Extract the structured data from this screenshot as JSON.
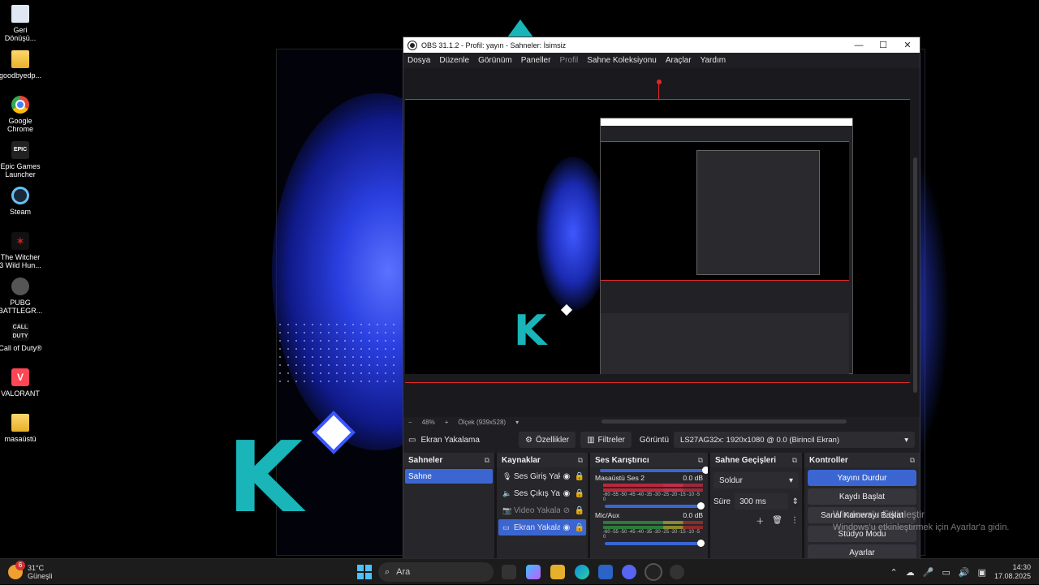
{
  "desktop": {
    "icons": [
      {
        "label": "Geri Dönüşü...",
        "icon": "recycle-bin-icon"
      },
      {
        "label": "goodbyedp...",
        "icon": "folder-icon"
      },
      {
        "label": "Google Chrome",
        "icon": "chrome-icon"
      },
      {
        "label": "Epic Games Launcher",
        "icon": "epic-games-icon"
      },
      {
        "label": "Steam",
        "icon": "steam-icon"
      },
      {
        "label": "The Witcher 3 Wild Hun...",
        "icon": "witcher-icon"
      },
      {
        "label": "PUBG BATTLEGR...",
        "icon": "pubg-icon"
      },
      {
        "label": "Call of Duty®",
        "icon": "cod-icon"
      },
      {
        "label": "VALORANT",
        "icon": "valorant-icon"
      },
      {
        "label": "masaüstü",
        "icon": "folder-icon"
      }
    ],
    "epic_text": "EPIC",
    "cod_text": "CALL DUTY",
    "valorant_text": "V",
    "big_k": "K"
  },
  "obs": {
    "title": "OBS 31.1.2 - Profil: yayın - Sahneler: İsimsiz",
    "window_buttons": {
      "minimize": "—",
      "maximize": "☐",
      "close": "✕"
    },
    "menu": [
      {
        "label": "Dosya"
      },
      {
        "label": "Düzenle"
      },
      {
        "label": "Görünüm"
      },
      {
        "label": "Paneller"
      },
      {
        "label": "Profil",
        "dim": true
      },
      {
        "label": "Sahne Koleksiyonu"
      },
      {
        "label": "Araçlar"
      },
      {
        "label": "Yardım"
      }
    ],
    "preview_status": {
      "zoom_minus": "−",
      "zoom": "48%",
      "zoom_plus": "+",
      "scale": "Ölçek (939x528)"
    },
    "source_toolbar": {
      "source_name": "Ekran Yakalama",
      "properties": "Özellikler",
      "filters": "Filtreler",
      "display_label": "Görüntü",
      "display_value": "LS27AG32x: 1920x1080 @ 0.0 (Birincil Ekran)"
    },
    "scenes": {
      "title": "Sahneler",
      "items": [
        "Sahne"
      ]
    },
    "sources": {
      "title": "Kaynaklar",
      "items": [
        {
          "name": "Ses Giriş Yakalama",
          "icon": "mic-icon",
          "visible": true,
          "dim": false,
          "selected": false
        },
        {
          "name": "Ses Çıkış Yakalama",
          "icon": "speaker-icon",
          "visible": true,
          "dim": false,
          "selected": false
        },
        {
          "name": "Video Yakalama",
          "icon": "camera-icon",
          "visible": false,
          "dim": true,
          "selected": false
        },
        {
          "name": "Ekran Yakalama",
          "icon": "monitor-icon",
          "visible": true,
          "dim": false,
          "selected": true
        }
      ]
    },
    "mixer": {
      "title": "Ses Karıştırıcı",
      "scale": "-60 -55 -50 -45 -40 -35 -30 -25 -20 -15 -10 -5 0",
      "channels": [
        {
          "name": "Masaüstü Ses 2",
          "db": "0.0 dB"
        },
        {
          "name": "Mic/Aux",
          "db": "0.0 dB"
        }
      ]
    },
    "transitions": {
      "title": "Sahne Geçişleri",
      "selected": "Soldur",
      "duration_label": "Süre",
      "duration": "300 ms"
    },
    "controls": {
      "title": "Kontroller",
      "buttons": [
        "Yayını Durdur",
        "Kaydı Başlat",
        "Sanal Kamerayı Başlat",
        "Stüdyo Modu",
        "Ayarlar"
      ]
    }
  },
  "watermark": {
    "line1": "Windows'u Etkinleştir",
    "line2": "Windows'u etkinleştirmek için Ayarlar'a gidin."
  },
  "taskbar": {
    "weather_temp": "31°C",
    "weather_desc": "Güneşli",
    "weather_badge": "6",
    "search_placeholder": "Ara",
    "time": "14:30",
    "date": "17.08.2025"
  }
}
